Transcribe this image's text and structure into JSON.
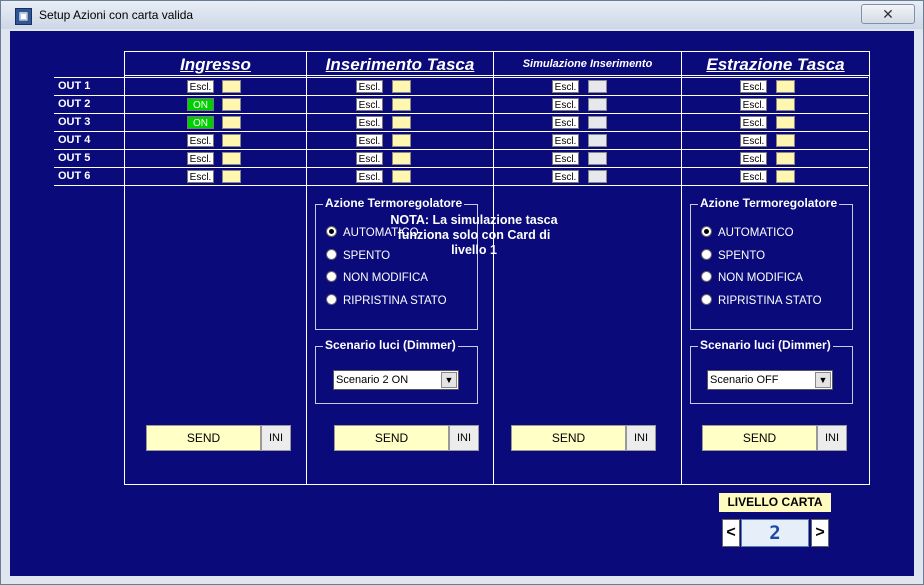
{
  "window": {
    "title": "Setup Azioni con carta valida",
    "close_glyph": "✕",
    "app_icon": "app-icon"
  },
  "columns": [
    {
      "header": "Ingresso"
    },
    {
      "header": "Inserimento Tasca"
    },
    {
      "header": "Simulazione Inserimento"
    },
    {
      "header": "Estrazione Tasca"
    }
  ],
  "outputs": [
    {
      "label": "OUT 1",
      "states": [
        "Escl.",
        "Escl.",
        "Escl.",
        "Escl."
      ]
    },
    {
      "label": "OUT 2",
      "states": [
        "ON",
        "Escl.",
        "Escl.",
        "Escl."
      ]
    },
    {
      "label": "OUT 3",
      "states": [
        "ON",
        "Escl.",
        "Escl.",
        "Escl."
      ]
    },
    {
      "label": "OUT 4",
      "states": [
        "Escl.",
        "Escl.",
        "Escl.",
        "Escl."
      ]
    },
    {
      "label": "OUT 5",
      "states": [
        "Escl.",
        "Escl.",
        "Escl.",
        "Escl."
      ]
    },
    {
      "label": "OUT 6",
      "states": [
        "Escl.",
        "Escl.",
        "Escl.",
        "Escl."
      ]
    }
  ],
  "inserimento": {
    "termo_title": "Azione Termoregolatore",
    "options": [
      "AUTOMATICO",
      "SPENTO",
      "NON MODIFICA",
      "RIPRISTINA STATO"
    ],
    "selected": "AUTOMATICO",
    "scenario_title": "Scenario luci (Dimmer)",
    "scenario_value": "Scenario 2 ON"
  },
  "estrazione": {
    "termo_title": "Azione Termoregolatore",
    "options": [
      "AUTOMATICO",
      "SPENTO",
      "NON MODIFICA",
      "RIPRISTINA STATO"
    ],
    "selected": "AUTOMATICO",
    "scenario_title": "Scenario luci (Dimmer)",
    "scenario_value": "Scenario OFF"
  },
  "nota": "NOTA: La simulazione tasca funziona solo con Card di livello 1",
  "buttons": {
    "send": "SEND",
    "ini": "INI"
  },
  "livello": {
    "label": "LIVELLO CARTA",
    "value": "2",
    "prev": "<",
    "next": ">"
  },
  "colors": {
    "panel": "#0a0a7a",
    "on": "#00d000",
    "send_bg": "#ffffc6",
    "indicator": "#fff6b0"
  }
}
